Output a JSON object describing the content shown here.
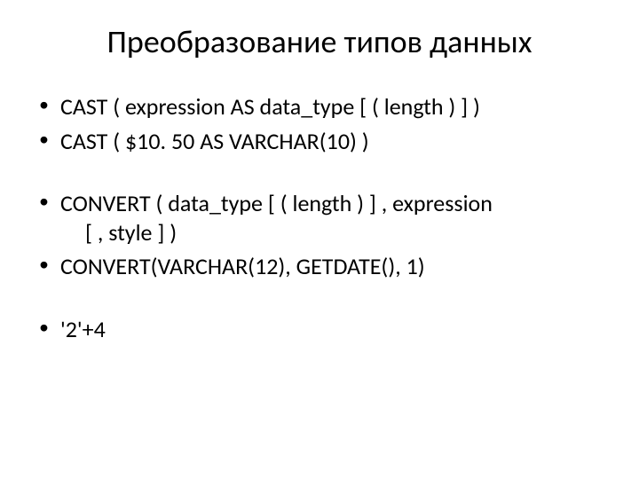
{
  "title": "Преобразование типов данных",
  "bullets": {
    "b1": "CAST ( expression AS data_type [ ( length ) ] )",
    "b2": "CAST ( $10. 50 AS VARCHAR(10) )",
    "b3_line1": "CONVERT ( data_type [ ( length ) ] , expression",
    "b3_line2": "[ , style ] )",
    "b4": "CONVERT(VARCHAR(12), GETDATE(), 1)",
    "b5": "'2'+4"
  }
}
